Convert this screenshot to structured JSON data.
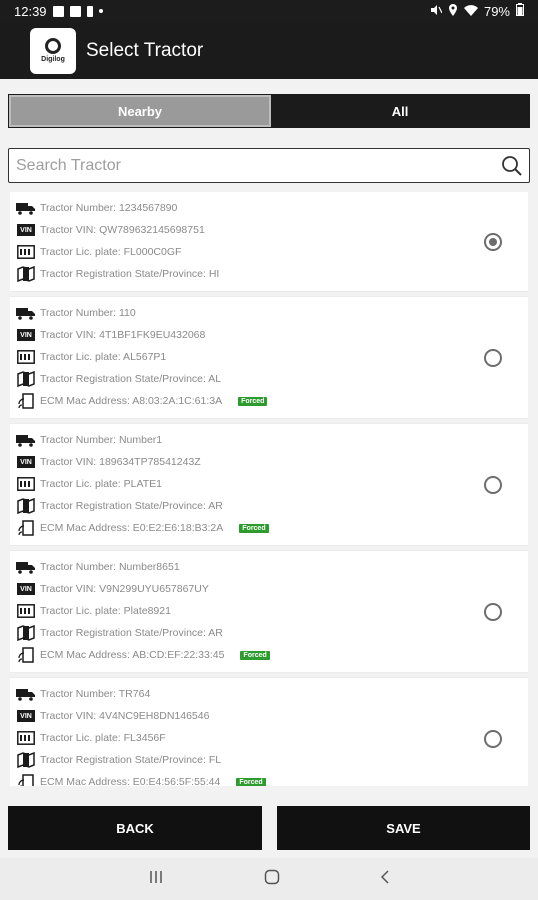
{
  "status_bar": {
    "time": "12:39",
    "battery": "79%"
  },
  "app_bar": {
    "title": "Select Tractor",
    "logo_text": "Digilog"
  },
  "tabs": [
    {
      "label": "Nearby",
      "active": true
    },
    {
      "label": "All",
      "active": false
    }
  ],
  "search": {
    "placeholder": "Search Tractor",
    "value": ""
  },
  "tractors": [
    {
      "number": "Tractor Number: 1234567890",
      "vin": "Tractor VIN: QW789632145698751",
      "plate": "Tractor Lic. plate: FL000C0GF",
      "state": "Tractor Registration State/Province: HI",
      "ecm": null,
      "forced": null,
      "selected": true
    },
    {
      "number": "Tractor Number: 110",
      "vin": "Tractor VIN: 4T1BF1FK9EU432068",
      "plate": "Tractor Lic. plate: AL567P1",
      "state": "Tractor Registration State/Province: AL",
      "ecm": "ECM Mac Address: A8:03:2A:1C:61:3A",
      "forced": "Forced",
      "selected": false
    },
    {
      "number": "Tractor Number: Number1",
      "vin": "Tractor VIN: 189634TP78541243Z",
      "plate": "Tractor Lic. plate: PLATE1",
      "state": "Tractor Registration State/Province: AR",
      "ecm": "ECM Mac Address: E0:E2:E6:18:B3:2A",
      "forced": "Forced",
      "selected": false
    },
    {
      "number": "Tractor Number: Number8651",
      "vin": "Tractor VIN: V9N299UYU657867UY",
      "plate": "Tractor Lic. plate: Plate8921",
      "state": "Tractor Registration State/Province: AR",
      "ecm": "ECM Mac Address: AB:CD:EF:22:33:45",
      "forced": "Forced",
      "selected": false
    },
    {
      "number": "Tractor Number: TR764",
      "vin": "Tractor VIN: 4V4NC9EH8DN146546",
      "plate": "Tractor Lic. plate: FL3456F",
      "state": "Tractor Registration State/Province: FL",
      "ecm": "ECM Mac Address: E0:E4:56:5F:55:44",
      "forced": "Forced",
      "selected": false
    }
  ],
  "buttons": {
    "back": "BACK",
    "save": "SAVE"
  },
  "colors": {
    "app_bar": "#1b1b1b",
    "forced_badge": "#2e9b2e",
    "tab_active": "#9a9a9a"
  }
}
